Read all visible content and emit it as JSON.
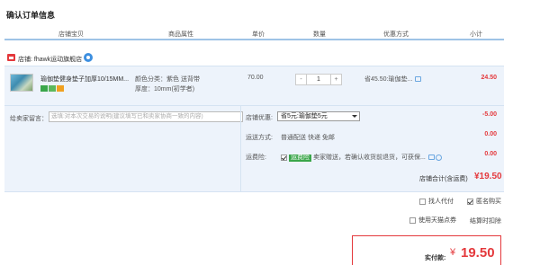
{
  "page": {
    "title": "确认订单信息"
  },
  "columns": [
    "店铺宝贝",
    "商品属性",
    "单价",
    "数量",
    "优惠方式",
    "小计"
  ],
  "store": {
    "label": "店铺: fhawk运动旗舰店"
  },
  "item": {
    "title": "瑜伽垫健身垫子加厚10/15MM...",
    "attr_color": "颜色分类：紫色 送背带",
    "attr_thickness": "厚度：10mm(初学者)",
    "price": "70.00",
    "quantity": "1",
    "minus": "-",
    "plus": "+",
    "promo": "省45.50:瑜伽垫...",
    "subtotal": "24.50",
    "badges": [
      "7-day-return-badge",
      "guarantee-badge",
      "credit-card-badge"
    ]
  },
  "message": {
    "label": "给卖家留言：",
    "placeholder": "选填:对本次交易的说明(建议填写已和卖家协商一致的内容)"
  },
  "store_discount": {
    "label": "店铺优惠:",
    "selected": "省5元:瑜伽垫5元",
    "value": "-5.00"
  },
  "shipping": {
    "label": "运送方式:",
    "text": "普通配送 快递 免邮",
    "value": "0.00"
  },
  "insurance": {
    "label": "运费险:",
    "tag": "运费险",
    "text": "卖家赠送，若确认收货前退货，可获保...",
    "value": "0.00",
    "checked": true
  },
  "store_total": {
    "label": "店铺合计(含运费)",
    "value": "¥19.50"
  },
  "options": {
    "proxy_pay": {
      "label": "找人代付",
      "checked": false
    },
    "anonymous": {
      "label": "匿名购买",
      "checked": true
    },
    "tmall_points": {
      "label": "使用天猫点券",
      "checked": false
    },
    "deduct_note": "结算时扣除"
  },
  "payment": {
    "label": "实付款:",
    "currency": "¥",
    "amount": "19.50"
  },
  "colors": {
    "accent": "#e4393c",
    "header_border": "#9ec3e6",
    "row_bg": "#edf3fb"
  }
}
